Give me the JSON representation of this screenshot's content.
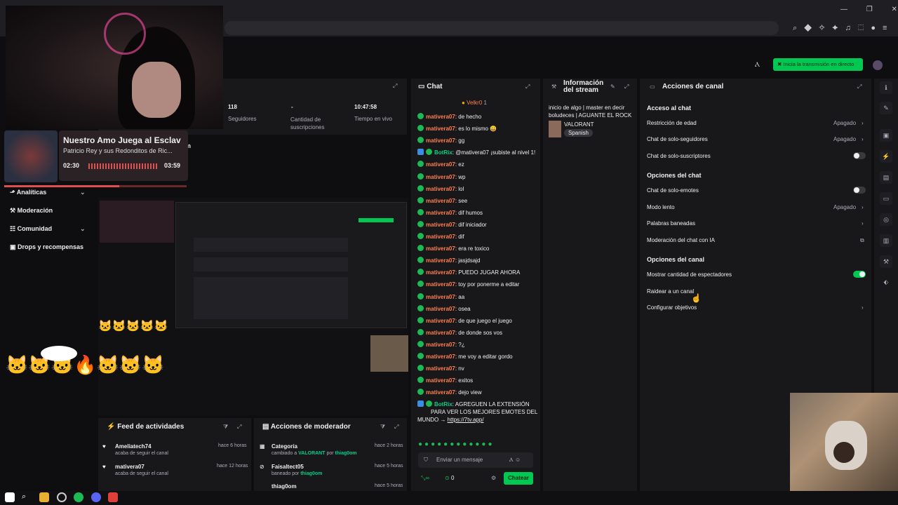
{
  "browser": {
    "controls": [
      "—",
      "❐",
      "✕"
    ]
  },
  "header": {
    "go_live": "Inicia la transmisión en directo"
  },
  "stats": {
    "followers_value": "118",
    "followers_label": "Seguidores",
    "subs_value": "-",
    "subs_label": "Cantidad de suscripciones",
    "live_value": "10:47:58",
    "live_label": "Tiempo en vivo"
  },
  "now_playing": {
    "title": "Nuestro Amo Juega al Esclav",
    "artist": "Patricio Rey y sus Redonditos de Ric...",
    "elapsed": "02:30",
    "total": "03:59",
    "progress_fraction": 0.63
  },
  "partial_heading": "m",
  "sidebar": {
    "items": [
      {
        "label": "Analíticas",
        "icon": "chart-icon"
      },
      {
        "label": "Moderación",
        "icon": "wrench-icon"
      },
      {
        "label": "Comunidad",
        "icon": "group-icon"
      },
      {
        "label": "Drops y recompensas",
        "icon": "gift-icon"
      }
    ]
  },
  "activity_feed": {
    "title": "Feed de actividades",
    "items": [
      {
        "user": "Ameliatech74",
        "desc": "acaba de seguir el canal",
        "time": "hace 6 horas"
      },
      {
        "user": "mativera07",
        "desc": "acaba de seguir el canal",
        "time": "hace 12 horas"
      }
    ]
  },
  "mod_actions": {
    "title": "Acciones de moderador",
    "items": [
      {
        "title": "Categoría",
        "desc_pre": "cambiado a ",
        "highlight": "VALORANT",
        "desc_mid": " por ",
        "by": "thiag0om",
        "time": "hace 2 horas"
      },
      {
        "title": "Faisaltect05",
        "desc_pre": "baneado por ",
        "highlight": "",
        "desc_mid": "",
        "by": "thiag0om",
        "time": "hace 5 horas"
      },
      {
        "title": "thiag0om",
        "desc_pre": "",
        "highlight": "",
        "desc_mid": "",
        "by": "",
        "time": "hace 5 horas"
      }
    ]
  },
  "chat": {
    "title": "Chat",
    "pinned_user": "Velkr0",
    "pinned_count": "1",
    "messages": [
      {
        "user": "mativera07",
        "text": ": de hecho"
      },
      {
        "user": "mativera07",
        "text": ": es lo mismo 😀"
      },
      {
        "user": "mativera07",
        "text": ": gg"
      },
      {
        "user": "BotRix",
        "text": ": @mativera07 ¡subiste al nivel 1!",
        "bot": true
      },
      {
        "user": "mativera07",
        "text": ": ez"
      },
      {
        "user": "mativera07",
        "text": ": wp"
      },
      {
        "user": "mativera07",
        "text": ": lol"
      },
      {
        "user": "mativera07",
        "text": ": see"
      },
      {
        "user": "mativera07",
        "text": ": dif humos"
      },
      {
        "user": "mativera07",
        "text": ": dif iniciador"
      },
      {
        "user": "mativera07",
        "text": ": dif"
      },
      {
        "user": "mativera07",
        "text": ": era re toxico"
      },
      {
        "user": "mativera07",
        "text": ": jasjdsajd"
      },
      {
        "user": "mativera07",
        "text": ": PUEDO JUGAR AHORA"
      },
      {
        "user": "mativera07",
        "text": ": toy por ponerme a editar"
      },
      {
        "user": "mativera07",
        "text": ": aa"
      },
      {
        "user": "mativera07",
        "text": ": osea"
      },
      {
        "user": "mativera07",
        "text": ": de que juego el juego"
      },
      {
        "user": "mativera07",
        "text": ": de donde sos vos"
      },
      {
        "user": "mativera07",
        "text": ": ?¿"
      },
      {
        "user": "mativera07",
        "text": ": me voy a editar gordo"
      },
      {
        "user": "mativera07",
        "text": ": nv"
      },
      {
        "user": "mativera07",
        "text": ": exitos"
      },
      {
        "user": "mativera07",
        "text": ": dejo view"
      }
    ],
    "bot_user": "BotRix",
    "bot_line1": ": AGREGUEN LA EXTENSIÓN",
    "bot_line2": "PARA VER LOS MEJORES EMOTES DEL",
    "bot_line3": "MUNDO → ",
    "bot_link": "https://7tv.app/",
    "input_placeholder": "Enviar un mensaje",
    "points": "0",
    "send_label": "Chatear"
  },
  "stream_info": {
    "title_line1": "Información",
    "title_line2": "del stream",
    "stream_title": "inicio de algo | master en decir boludeces | AGUANTE EL ROCK |",
    "category": "VALORANT",
    "tag": "Spanish"
  },
  "channel_actions": {
    "title": "Acciones de canal",
    "sections": [
      {
        "name": "Acceso al chat"
      },
      {
        "name": "Opciones del chat"
      },
      {
        "name": "Opciones del canal"
      }
    ],
    "rows": [
      {
        "label": "Restricción de edad",
        "value": "Apagado",
        "kind": "chevron"
      },
      {
        "label": "Chat de solo-seguidores",
        "value": "Apagado",
        "kind": "chevron"
      },
      {
        "label": "Chat de solo-suscriptores",
        "value": "",
        "kind": "toggle-off"
      },
      {
        "label": "Chat de solo-emotes",
        "value": "",
        "kind": "toggle-off"
      },
      {
        "label": "Modo lento",
        "value": "Apagado",
        "kind": "chevron"
      },
      {
        "label": "Palabras baneadas",
        "value": "",
        "kind": "chevron"
      },
      {
        "label": "Moderación del chat con IA",
        "value": "",
        "kind": "external"
      },
      {
        "label": "Mostrar cantidad de espectadores",
        "value": "",
        "kind": "toggle-on"
      },
      {
        "label": "Raidear a un canal",
        "value": "",
        "kind": "none"
      },
      {
        "label": "Configurar objetivos",
        "value": "",
        "kind": "chevron"
      }
    ]
  },
  "colors": {
    "accent": "#00c853",
    "username": "#ff7f50",
    "panel": "#18181b",
    "bg": "#0e0e10"
  }
}
